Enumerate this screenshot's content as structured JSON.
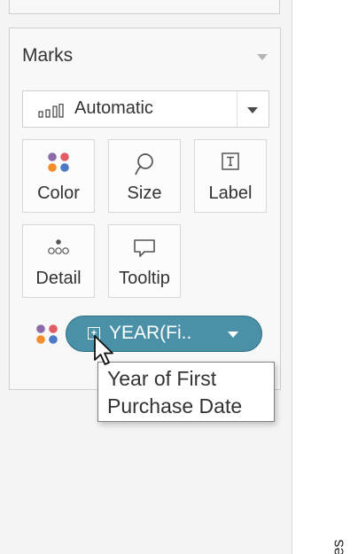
{
  "marks_card": {
    "title": "Marks",
    "collapse_icon": "chevron-down-icon",
    "mark_type": {
      "label": "Automatic",
      "icon": "bar-chart-icon"
    },
    "buttons": [
      {
        "label": "Color",
        "icon": "color-dots-icon"
      },
      {
        "label": "Size",
        "icon": "size-lasso-icon"
      },
      {
        "label": "Label",
        "icon": "text-label-icon"
      },
      {
        "label": "Detail",
        "icon": "detail-dots-icon"
      },
      {
        "label": "Tooltip",
        "icon": "speech-bubble-icon"
      }
    ]
  },
  "pill": {
    "field_label": "YEAR(Fi..",
    "encoding_icon": "color-dots-icon",
    "field_icon": "date-field-icon",
    "color": "#4a91a8"
  },
  "tooltip": {
    "line1": "Year of First",
    "line2": "Purchase Date"
  },
  "view": {
    "axis_label_fragment": "ales"
  }
}
